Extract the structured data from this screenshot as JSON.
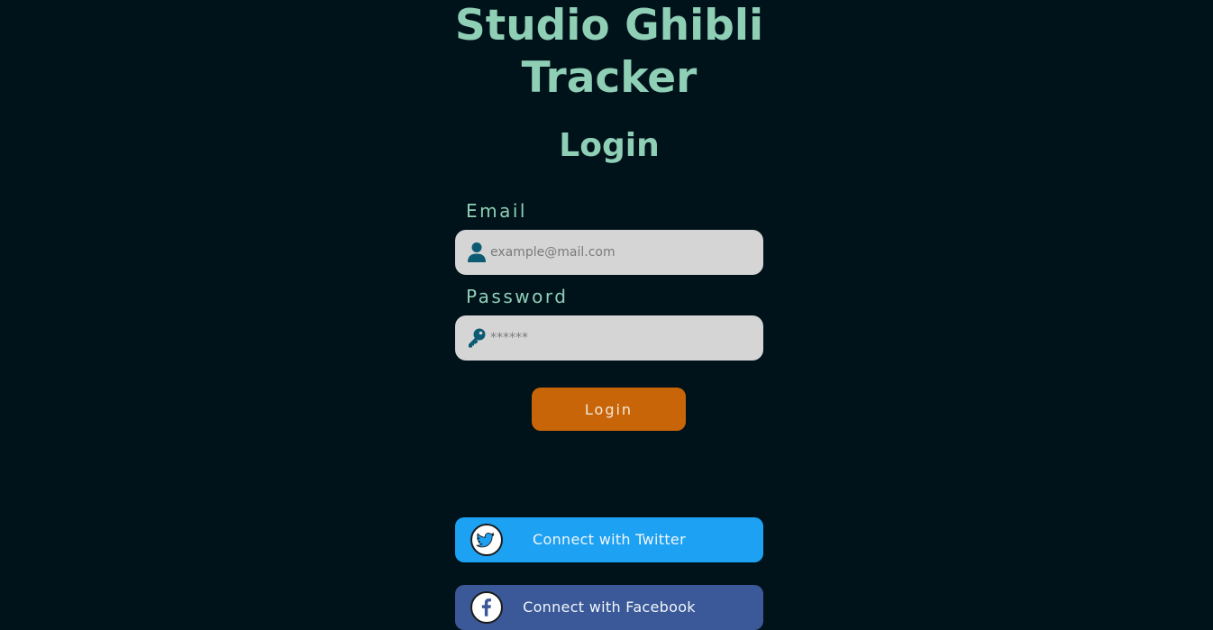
{
  "header": {
    "app_title_line1": "Studio Ghibli",
    "app_title_line2": "Tracker"
  },
  "form": {
    "title": "Login",
    "email": {
      "label": "Email",
      "placeholder": "example@mail.com",
      "value": "",
      "icon": "user-icon"
    },
    "password": {
      "label": "Password",
      "placeholder": "******",
      "value": "",
      "icon": "key-icon"
    },
    "submit_label": "Login"
  },
  "social": {
    "twitter": {
      "label": "Connect with Twitter",
      "icon": "twitter-bird-icon",
      "color": "#1da1f2"
    },
    "facebook": {
      "label": "Connect with Facebook",
      "icon": "facebook-icon",
      "color": "#3b5998"
    }
  },
  "colors": {
    "background": "#00121a",
    "accent": "#8fcfb6",
    "primary_button": "#c86508",
    "input_bg": "#d5d5d5"
  }
}
